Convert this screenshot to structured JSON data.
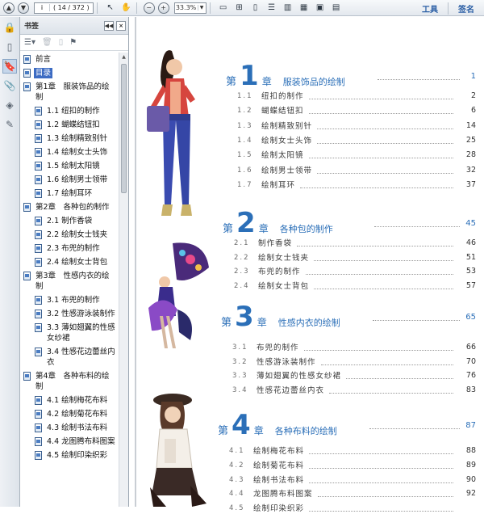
{
  "toolbar": {
    "page_value": "i",
    "page_total": "( 14 / 372 )",
    "zoom": "33.3%",
    "tools_label": "工具",
    "sign_label": "签名"
  },
  "panel": {
    "title": "书签"
  },
  "bookmarks": [
    {
      "label": "前言",
      "level": 0
    },
    {
      "label": "目录",
      "level": 0,
      "selected": true
    },
    {
      "label": "第1章　服装饰品的绘制",
      "level": 0
    },
    {
      "label": "1.1  纽扣的制作",
      "level": 1
    },
    {
      "label": "1.2  蝴蝶结钮扣",
      "level": 1
    },
    {
      "label": "1.3  绘制精致别针",
      "level": 1
    },
    {
      "label": "1.4  绘制女士头饰",
      "level": 1
    },
    {
      "label": "1.5  绘制太阳镜",
      "level": 1
    },
    {
      "label": "1.6  绘制男士领带",
      "level": 1
    },
    {
      "label": "1.7  绘制耳环",
      "level": 1
    },
    {
      "label": "第2章　各种包的制作",
      "level": 0
    },
    {
      "label": "2.1  制作香袋",
      "level": 1
    },
    {
      "label": "2.2  绘制女士钱夹",
      "level": 1
    },
    {
      "label": "2.3  布兜的制作",
      "level": 1
    },
    {
      "label": "2.4  绘制女士背包",
      "level": 1
    },
    {
      "label": "第3章　性感内衣的绘制",
      "level": 0
    },
    {
      "label": "3.1  布兜的制作",
      "level": 1
    },
    {
      "label": "3.2  性感游泳装制作",
      "level": 1
    },
    {
      "label": "3.3  薄如翅翼的性感女纱裙",
      "level": 1
    },
    {
      "label": "3.4  性感花边蕾丝内衣",
      "level": 1
    },
    {
      "label": "第4章　各种布料的绘制",
      "level": 0
    },
    {
      "label": "4.1  绘制梅花布料",
      "level": 1
    },
    {
      "label": "4.2  绘制菊花布料",
      "level": 1
    },
    {
      "label": "4.3  绘制书法布料",
      "level": 1
    },
    {
      "label": "4.4  龙图腾布料图案",
      "level": 1
    },
    {
      "label": "4.5  绘制印染织彩",
      "level": 1
    }
  ],
  "toc": {
    "chapters": [
      {
        "di": "第",
        "num": "1",
        "zhang": "章",
        "title": "服装饰品的绘制",
        "page": "1",
        "items": [
          {
            "num": "1.1",
            "title": "纽扣的制作",
            "page": "2"
          },
          {
            "num": "1.2",
            "title": "蝴蝶结钮扣",
            "page": "6"
          },
          {
            "num": "1.3",
            "title": "绘制精致别针",
            "page": "14"
          },
          {
            "num": "1.4",
            "title": "绘制女士头饰",
            "page": "25"
          },
          {
            "num": "1.5",
            "title": "绘制太阳镜",
            "page": "28"
          },
          {
            "num": "1.6",
            "title": "绘制男士领带",
            "page": "32"
          },
          {
            "num": "1.7",
            "title": "绘制耳环",
            "page": "37"
          }
        ]
      },
      {
        "di": "第",
        "num": "2",
        "zhang": "章",
        "title": "各种包的制作",
        "page": "45",
        "items": [
          {
            "num": "2.1",
            "title": "制作香袋",
            "page": "46"
          },
          {
            "num": "2.2",
            "title": "绘制女士钱夹",
            "page": "51"
          },
          {
            "num": "2.3",
            "title": "布兜的制作",
            "page": "53"
          },
          {
            "num": "2.4",
            "title": "绘制女士背包",
            "page": "57"
          }
        ]
      },
      {
        "di": "第",
        "num": "3",
        "zhang": "章",
        "title": "性感内衣的绘制",
        "page": "65",
        "items": [
          {
            "num": "3.1",
            "title": "布兜的制作",
            "page": "66"
          },
          {
            "num": "3.2",
            "title": "性感游泳装制作",
            "page": "70"
          },
          {
            "num": "3.3",
            "title": "薄如翅翼的性感女纱裙",
            "page": "76"
          },
          {
            "num": "3.4",
            "title": "性感花边蕾丝内衣",
            "page": "83"
          }
        ]
      },
      {
        "di": "第",
        "num": "4",
        "zhang": "章",
        "title": "各种布料的绘制",
        "page": "87",
        "items": [
          {
            "num": "4.1",
            "title": "绘制梅花布料",
            "page": "88"
          },
          {
            "num": "4.2",
            "title": "绘制菊花布料",
            "page": "89"
          },
          {
            "num": "4.3",
            "title": "绘制书法布料",
            "page": "90"
          },
          {
            "num": "4.4",
            "title": "龙图腾布料图案",
            "page": "92"
          },
          {
            "num": "4.5",
            "title": "绘制印染织彩",
            "page": ""
          }
        ]
      }
    ]
  },
  "colors": {
    "accent_blue": "#2b6fb8",
    "selection": "#3d6cc3"
  }
}
